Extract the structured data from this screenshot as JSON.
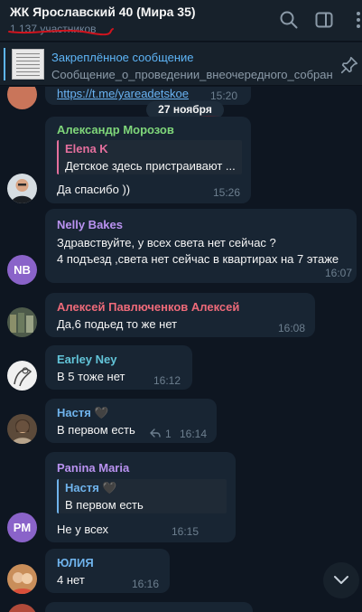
{
  "header": {
    "title": "ЖК Ярославский 40 (Мира 35)",
    "members": "1 137 участников"
  },
  "pinned": {
    "title": "Закреплённое сообщение",
    "text": "Сообщение_о_проведении_внеочередного_собрания"
  },
  "date_divider": "27 ноября",
  "messages": [
    {
      "text": "https://t.me/yareadetskoe",
      "time": "15:20"
    },
    {
      "sender": "Александр Морозов",
      "reply_name": "Elena K",
      "reply_text": "Детское здесь пристраивают ...",
      "text": "Да спасибо ))",
      "time": "15:26"
    },
    {
      "sender": "Nelly Bakes",
      "line1": "Здравствуйте, у всех света нет сейчас ?",
      "line2": "4 подъезд ,света нет сейчас в квартирах на 7 этаже",
      "time": "16:07",
      "initials": "NB"
    },
    {
      "sender": "Алексей Павлюченков Алексей",
      "text": "Да,6 подьед то же нет",
      "time": "16:08"
    },
    {
      "sender": "Earley Ney",
      "text": "В 5 тоже нет",
      "time": "16:12"
    },
    {
      "sender": "Настя 🖤",
      "text": "В первом есть",
      "replies": "1",
      "time": "16:14"
    },
    {
      "sender": "Panina Maria",
      "reply_name": "Настя 🖤",
      "reply_text": "В первом есть",
      "text": "Не у всех",
      "time": "16:15",
      "initials": "PM"
    },
    {
      "sender": "ЮЛИЯ",
      "text": "4 нет",
      "time": "16:16"
    }
  ],
  "colors": {
    "background": "#0e1621",
    "bubble": "#182533",
    "header": "#17212b",
    "accent": "#5eb5f7",
    "annotation": "#d0141e",
    "name_green": "#7fd67a",
    "name_pink": "#e56f9d",
    "name_purple": "#b992f0",
    "name_red": "#ee6a79",
    "name_cyan": "#62c4d8",
    "name_blue": "#6fb3ec",
    "avatar_purple": "#8a63c9"
  },
  "icons": [
    "search-icon",
    "sidebar-toggle-icon",
    "more-vert-icon",
    "pin-icon",
    "reply-arrow-icon",
    "chevron-down-icon"
  ]
}
